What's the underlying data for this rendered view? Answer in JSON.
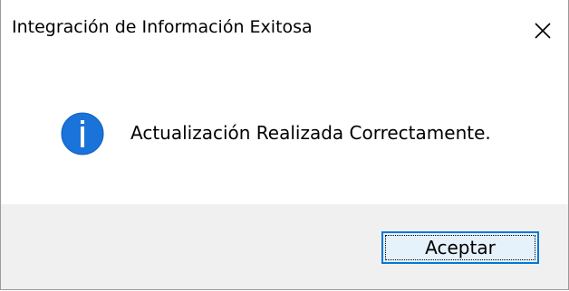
{
  "window": {
    "title": "Integración de Información Exitosa"
  },
  "message": {
    "text": "Actualización Realizada Correctamente."
  },
  "buttons": {
    "accept_label": "Aceptar"
  },
  "icons": {
    "close": "close-icon",
    "info": "info-icon"
  },
  "colors": {
    "info_icon": "#1a73d9",
    "button_border": "#0078d7",
    "button_bg": "#e5f1fb",
    "footer_bg": "#f0f0f0"
  }
}
